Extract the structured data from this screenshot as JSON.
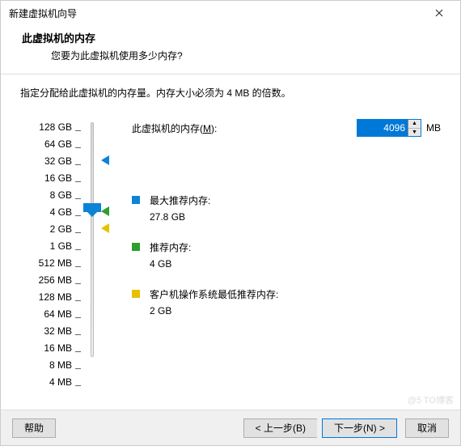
{
  "window": {
    "title": "新建虚拟机向导"
  },
  "header": {
    "title": "此虚拟机的内存",
    "subtitle": "您要为此虚拟机使用多少内存?"
  },
  "intro": "指定分配给此虚拟机的内存量。内存大小必须为 4 MB 的倍数。",
  "memory": {
    "label_prefix": "此虚拟机的内存(",
    "label_hotkey": "M",
    "label_suffix": "):",
    "value": "4096",
    "unit": "MB"
  },
  "slider": {
    "labels": [
      "128 GB",
      "64 GB",
      "32 GB",
      "16 GB",
      "8 GB",
      "4 GB",
      "2 GB",
      "1 GB",
      "512 MB",
      "256 MB",
      "128 MB",
      "64 MB",
      "32 MB",
      "16 MB",
      "8 MB",
      "4 MB"
    ],
    "markers": {
      "max": {
        "color": "#0b84d8",
        "index": 2
      },
      "rec": {
        "color": "#2e9e2e",
        "index": 5
      },
      "min": {
        "color": "#e6c100",
        "index": 6
      }
    },
    "thumb_index": 5
  },
  "info": {
    "max": {
      "label": "最大推荐内存:",
      "value": "27.8 GB",
      "color": "#0b84d8"
    },
    "rec": {
      "label": "推荐内存:",
      "value": "4 GB",
      "color": "#2e9e2e"
    },
    "min": {
      "label": "客户机操作系统最低推荐内存:",
      "value": "2 GB",
      "color": "#e6c100"
    }
  },
  "buttons": {
    "help": "帮助",
    "back": "< 上一步(B)",
    "next": "下一步(N) >",
    "cancel": "取消"
  },
  "watermark": "@5 TO博客"
}
